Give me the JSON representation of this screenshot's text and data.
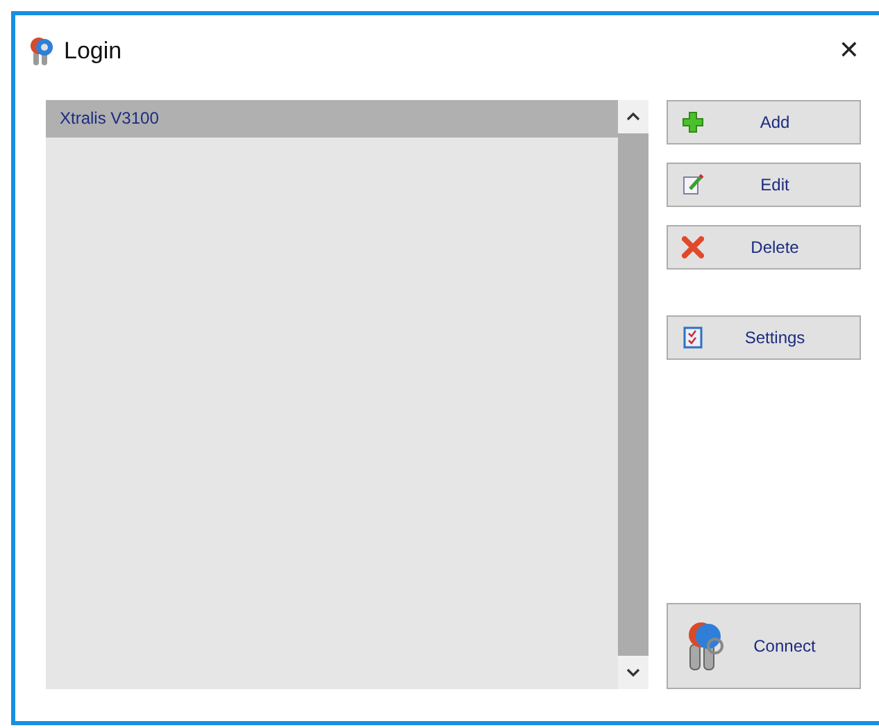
{
  "window": {
    "title": "Login",
    "close": "✕"
  },
  "list": {
    "items": [
      {
        "label": "Xtralis V3100",
        "selected": true
      }
    ]
  },
  "buttons": [
    {
      "label": "Add",
      "kind": "add"
    },
    {
      "label": "Edit",
      "kind": "edit"
    },
    {
      "label": "Delete",
      "kind": "delete"
    },
    {
      "label": "Settings",
      "kind": "settings"
    }
  ],
  "connect": {
    "label": "Connect"
  }
}
